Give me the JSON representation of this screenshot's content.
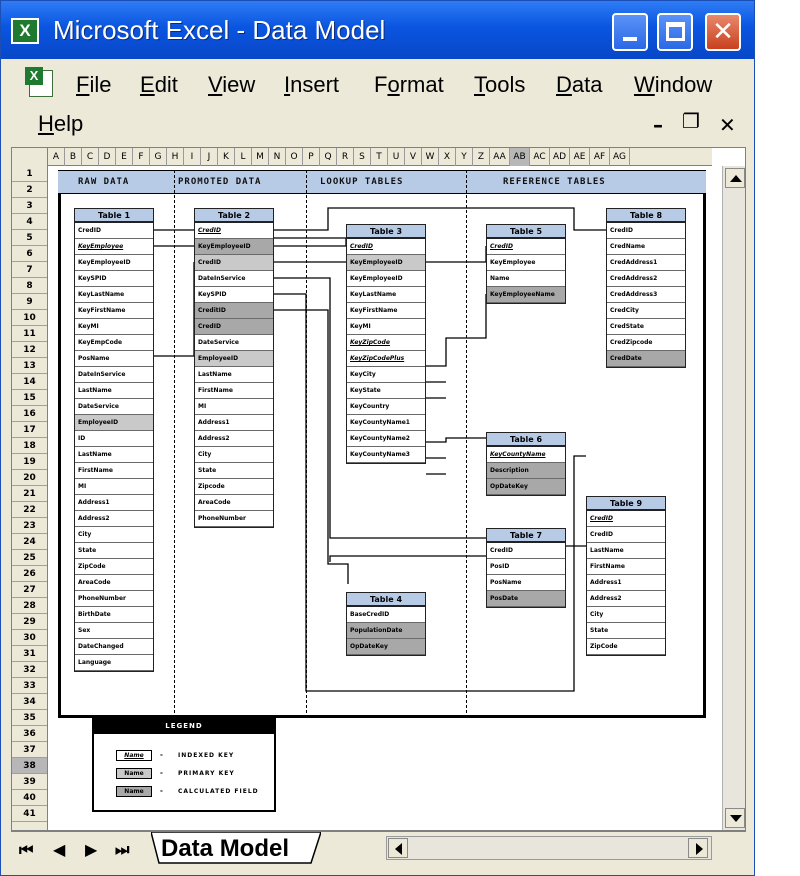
{
  "window": {
    "app_icon": "excel-icon",
    "title": "Microsoft Excel - Data Model",
    "close_glyph": "✕"
  },
  "menu": {
    "items": [
      "File",
      "Edit",
      "View",
      "Insert",
      "Format",
      "Tools",
      "Data",
      "Window",
      "Help"
    ],
    "mnemonics": [
      "F",
      "E",
      "V",
      "I",
      "o",
      "T",
      "D",
      "W",
      "H"
    ],
    "doc_minimize": "–",
    "doc_restore": "❐",
    "doc_close": "✕"
  },
  "grid": {
    "columns": [
      "A",
      "B",
      "C",
      "D",
      "E",
      "F",
      "G",
      "H",
      "I",
      "J",
      "K",
      "L",
      "M",
      "N",
      "O",
      "P",
      "Q",
      "R",
      "S",
      "T",
      "U",
      "V",
      "W",
      "X",
      "Y",
      "Z",
      "AA",
      "AB",
      "AC",
      "AD",
      "AE",
      "AF",
      "AG"
    ],
    "selected_column": "AB",
    "rows": [
      "1",
      "2",
      "3",
      "4",
      "5",
      "6",
      "7",
      "8",
      "9",
      "10",
      "11",
      "12",
      "13",
      "14",
      "15",
      "16",
      "17",
      "18",
      "19",
      "20",
      "21",
      "22",
      "23",
      "24",
      "25",
      "26",
      "27",
      "28",
      "29",
      "30",
      "31",
      "32",
      "33",
      "34",
      "35",
      "36",
      "37",
      "38",
      "39",
      "40",
      "41"
    ],
    "selected_row": "38"
  },
  "bands": [
    {
      "label": "RAW DATA"
    },
    {
      "label": "PROMOTED DATA"
    },
    {
      "label": "LOOKUP TABLES"
    },
    {
      "label": "REFERENCE TABLES"
    }
  ],
  "tables": {
    "t1": {
      "title": "Table 1",
      "fields": [
        {
          "name": "CredID",
          "style": "plain"
        },
        {
          "name": "KeyEmployee",
          "style": "idx"
        },
        {
          "name": "KeyEmployeeID",
          "style": "plain"
        },
        {
          "name": "KeySPID",
          "style": "plain"
        },
        {
          "name": "KeyLastName",
          "style": "plain"
        },
        {
          "name": "KeyFirstName",
          "style": "plain"
        },
        {
          "name": "KeyMI",
          "style": "plain"
        },
        {
          "name": "KeyEmpCode",
          "style": "plain"
        },
        {
          "name": "PosName",
          "style": "plain"
        },
        {
          "name": "DateInService",
          "style": "plain"
        },
        {
          "name": "LastName",
          "style": "plain"
        },
        {
          "name": "DateService",
          "style": "plain"
        },
        {
          "name": "EmployeeID",
          "style": "pk"
        },
        {
          "name": "ID",
          "style": "plain"
        },
        {
          "name": "LastName",
          "style": "plain"
        },
        {
          "name": "FirstName",
          "style": "plain"
        },
        {
          "name": "MI",
          "style": "plain"
        },
        {
          "name": "Address1",
          "style": "plain"
        },
        {
          "name": "Address2",
          "style": "plain"
        },
        {
          "name": "City",
          "style": "plain"
        },
        {
          "name": "State",
          "style": "plain"
        },
        {
          "name": "ZipCode",
          "style": "plain"
        },
        {
          "name": "AreaCode",
          "style": "plain"
        },
        {
          "name": "PhoneNumber",
          "style": "plain"
        },
        {
          "name": "BirthDate",
          "style": "plain"
        },
        {
          "name": "Sex",
          "style": "plain"
        },
        {
          "name": "DateChanged",
          "style": "plain"
        },
        {
          "name": "Language",
          "style": "plain"
        }
      ]
    },
    "t2": {
      "title": "Table 2",
      "fields": [
        {
          "name": "CredID",
          "style": "idx"
        },
        {
          "name": "KeyEmployeeID",
          "style": "calc"
        },
        {
          "name": "CredID",
          "style": "pk"
        },
        {
          "name": "DateInService",
          "style": "plain"
        },
        {
          "name": "KeySPID",
          "style": "plain"
        },
        {
          "name": "CreditID",
          "style": "calc"
        },
        {
          "name": "CredID",
          "style": "calc"
        },
        {
          "name": "DateService",
          "style": "plain"
        },
        {
          "name": "EmployeeID",
          "style": "pk"
        },
        {
          "name": "LastName",
          "style": "plain"
        },
        {
          "name": "FirstName",
          "style": "plain"
        },
        {
          "name": "MI",
          "style": "plain"
        },
        {
          "name": "Address1",
          "style": "plain"
        },
        {
          "name": "Address2",
          "style": "plain"
        },
        {
          "name": "City",
          "style": "plain"
        },
        {
          "name": "State",
          "style": "plain"
        },
        {
          "name": "Zipcode",
          "style": "plain"
        },
        {
          "name": "AreaCode",
          "style": "plain"
        },
        {
          "name": "PhoneNumber",
          "style": "plain"
        }
      ]
    },
    "t3": {
      "title": "Table 3",
      "fields": [
        {
          "name": "CredID",
          "style": "idx"
        },
        {
          "name": "KeyEmployeeID",
          "style": "pk"
        },
        {
          "name": "KeyEmployeeID",
          "style": "plain"
        },
        {
          "name": "KeyLastName",
          "style": "plain"
        },
        {
          "name": "KeyFirstName",
          "style": "plain"
        },
        {
          "name": "KeyMI",
          "style": "plain"
        },
        {
          "name": "KeyZipCode",
          "style": "idx"
        },
        {
          "name": "KeyZipCodePlus",
          "style": "idx"
        },
        {
          "name": "KeyCity",
          "style": "plain"
        },
        {
          "name": "KeyState",
          "style": "plain"
        },
        {
          "name": "KeyCountry",
          "style": "plain"
        },
        {
          "name": "KeyCountyName1",
          "style": "plain"
        },
        {
          "name": "KeyCountyName2",
          "style": "plain"
        },
        {
          "name": "KeyCountyName3",
          "style": "plain"
        }
      ]
    },
    "t4": {
      "title": "Table 4",
      "fields": [
        {
          "name": "BaseCredID",
          "style": "plain"
        },
        {
          "name": "PopulationDate",
          "style": "calc"
        },
        {
          "name": "OpDateKey",
          "style": "calc"
        }
      ]
    },
    "t5": {
      "title": "Table 5",
      "fields": [
        {
          "name": "CredID",
          "style": "idx"
        },
        {
          "name": "KeyEmployee",
          "style": "plain"
        },
        {
          "name": "Name",
          "style": "plain"
        },
        {
          "name": "KeyEmployeeName",
          "style": "calc"
        }
      ]
    },
    "t6": {
      "title": "Table 6",
      "fields": [
        {
          "name": "KeyCountyName",
          "style": "idx"
        },
        {
          "name": "Description",
          "style": "calc"
        },
        {
          "name": "OpDateKey",
          "style": "calc"
        }
      ]
    },
    "t7": {
      "title": "Table 7",
      "fields": [
        {
          "name": "CredID",
          "style": "plain"
        },
        {
          "name": "PosID",
          "style": "plain"
        },
        {
          "name": "PosName",
          "style": "plain"
        },
        {
          "name": "PosDate",
          "style": "calc"
        }
      ]
    },
    "t8": {
      "title": "Table 8",
      "fields": [
        {
          "name": "CredID",
          "style": "plain"
        },
        {
          "name": "CredName",
          "style": "plain"
        },
        {
          "name": "CredAddress1",
          "style": "plain"
        },
        {
          "name": "CredAddress2",
          "style": "plain"
        },
        {
          "name": "CredAddress3",
          "style": "plain"
        },
        {
          "name": "CredCity",
          "style": "plain"
        },
        {
          "name": "CredState",
          "style": "plain"
        },
        {
          "name": "CredZipcode",
          "style": "plain"
        },
        {
          "name": "CredDate",
          "style": "calc"
        }
      ]
    },
    "t9": {
      "title": "Table 9",
      "fields": [
        {
          "name": "CredID",
          "style": "idx"
        },
        {
          "name": "CredID",
          "style": "plain"
        },
        {
          "name": "LastName",
          "style": "plain"
        },
        {
          "name": "FirstName",
          "style": "plain"
        },
        {
          "name": "Address1",
          "style": "plain"
        },
        {
          "name": "Address2",
          "style": "plain"
        },
        {
          "name": "City",
          "style": "plain"
        },
        {
          "name": "State",
          "style": "plain"
        },
        {
          "name": "ZipCode",
          "style": "plain"
        }
      ]
    }
  },
  "legend": {
    "title": "LEGEND",
    "rows": [
      {
        "swatch": "Name",
        "dash": "-",
        "label": "INDEXED KEY"
      },
      {
        "swatch": "Name",
        "dash": "-",
        "label": "PRIMARY KEY"
      },
      {
        "swatch": "Name",
        "dash": "-",
        "label": "CALCULATED FIELD"
      }
    ]
  },
  "sheet_tab": {
    "label": "Data Model"
  },
  "nav_glyphs": {
    "first": "⏮",
    "prev": "◀",
    "next": "▶",
    "last": "⏭"
  }
}
